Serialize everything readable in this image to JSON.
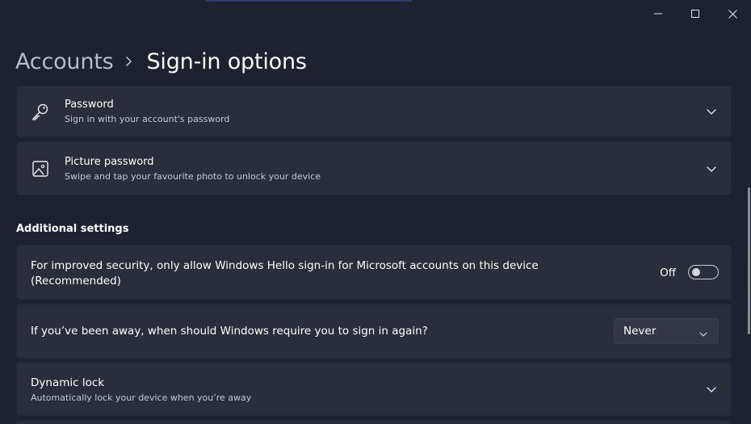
{
  "window": {
    "minimize_icon": "minimize-icon",
    "maximize_icon": "maximize-icon",
    "close_icon": "close-icon"
  },
  "breadcrumb": {
    "parent": "Accounts",
    "current": "Sign-in options"
  },
  "password_card": {
    "title": "Password",
    "subtitle": "Sign in with your account's password",
    "icon": "key-icon"
  },
  "picture_password_card": {
    "title": "Picture password",
    "subtitle": "Swipe and tap your favourite photo to unlock your device",
    "icon": "picture-icon"
  },
  "additional_settings": {
    "header": "Additional settings",
    "windows_hello": {
      "line1": "For improved security, only allow Windows Hello sign-in for Microsoft accounts on this device",
      "line2": "(Recommended)",
      "toggle_label": "Off",
      "toggle_on": false
    },
    "require_signin": {
      "text": "If you’ve been away, when should Windows require you to sign in again?",
      "selected": "Never"
    },
    "dynamic_lock": {
      "title": "Dynamic lock",
      "subtitle": "Automatically lock your device when you’re away"
    }
  },
  "colors": {
    "background": "#1f2330",
    "card": "#2a2e3b",
    "text": "#ffffff",
    "secondary_text": "#c6c9d0"
  }
}
